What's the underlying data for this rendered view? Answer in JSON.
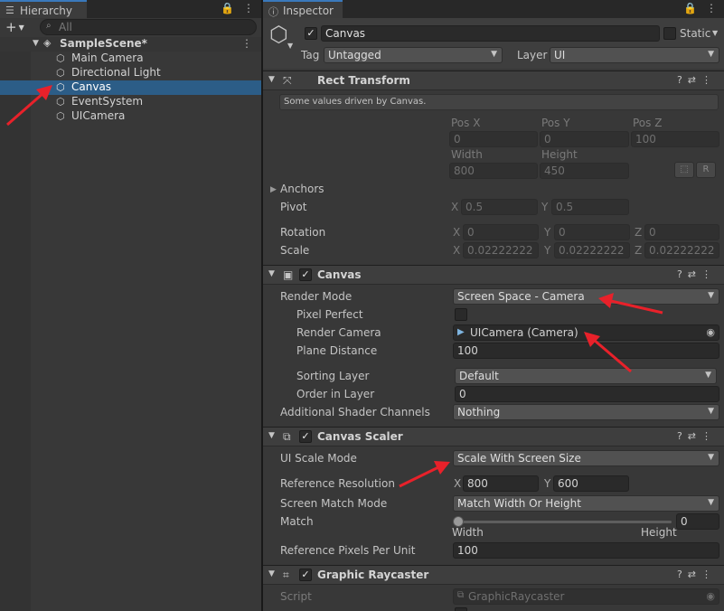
{
  "hierarchy": {
    "tab_label": "Hierarchy",
    "search_placeholder": "All",
    "scene_name": "SampleScene*",
    "items": [
      {
        "label": "Main Camera"
      },
      {
        "label": "Directional Light"
      },
      {
        "label": "Canvas"
      },
      {
        "label": "EventSystem"
      },
      {
        "label": "UICamera"
      }
    ]
  },
  "inspector": {
    "tab_label": "Inspector",
    "object_name": "Canvas",
    "static_label": "Static",
    "tag_label": "Tag",
    "tag_value": "Untagged",
    "layer_label": "Layer",
    "layer_value": "UI",
    "rect_transform": {
      "title": "Rect Transform",
      "note": "Some values driven by Canvas.",
      "pos_x_label": "Pos X",
      "pos_y_label": "Pos Y",
      "pos_z_label": "Pos Z",
      "pos_x": "0",
      "pos_y": "0",
      "pos_z": "100",
      "width_label": "Width",
      "height_label": "Height",
      "width": "800",
      "height": "450",
      "r_label": "R",
      "anchors_label": "Anchors",
      "pivot_label": "Pivot",
      "pivot_x": "0.5",
      "pivot_y": "0.5",
      "rotation_label": "Rotation",
      "rot_x": "0",
      "rot_y": "0",
      "rot_z": "0",
      "scale_label": "Scale",
      "scale_x": "0.02222222",
      "scale_y": "0.02222222",
      "scale_z": "0.02222222",
      "x": "X",
      "y": "Y",
      "z": "Z"
    },
    "canvas": {
      "title": "Canvas",
      "render_mode_label": "Render Mode",
      "render_mode": "Screen Space - Camera",
      "pixel_perfect_label": "Pixel Perfect",
      "render_camera_label": "Render Camera",
      "render_camera": "UICamera (Camera)",
      "plane_distance_label": "Plane Distance",
      "plane_distance": "100",
      "sorting_layer_label": "Sorting Layer",
      "sorting_layer": "Default",
      "order_label": "Order in Layer",
      "order": "0",
      "shader_channels_label": "Additional Shader Channels",
      "shader_channels": "Nothing"
    },
    "canvas_scaler": {
      "title": "Canvas Scaler",
      "ui_scale_mode_label": "UI Scale Mode",
      "ui_scale_mode": "Scale With Screen Size",
      "ref_res_label": "Reference Resolution",
      "ref_x": "800",
      "ref_y": "600",
      "match_mode_label": "Screen Match Mode",
      "match_mode": "Match Width Or Height",
      "match_label": "Match",
      "match_value": "0",
      "width_hint": "Width",
      "height_hint": "Height",
      "ref_ppu_label": "Reference Pixels Per Unit",
      "ref_ppu": "100"
    },
    "graphic_raycaster": {
      "title": "Graphic Raycaster",
      "script_label": "Script",
      "script_value": "GraphicRaycaster"
    }
  },
  "colors": {
    "selection": "#2c5d87",
    "annotation_arrow": "#e8212a",
    "tab_accent": "#3a79bb"
  }
}
